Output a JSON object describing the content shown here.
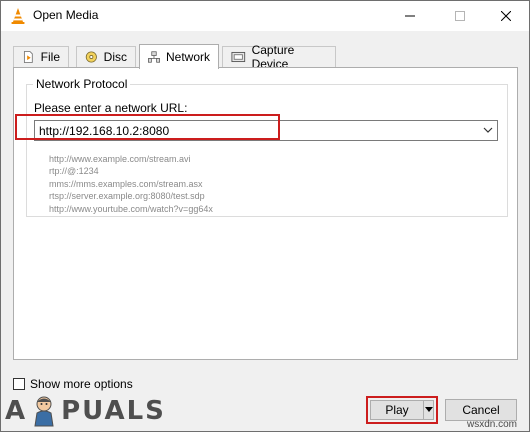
{
  "window": {
    "title": "Open Media"
  },
  "tabs": [
    {
      "label": "File",
      "icon": "file-icon",
      "active": false
    },
    {
      "label": "Disc",
      "icon": "disc-icon",
      "active": false
    },
    {
      "label": "Network",
      "icon": "network-icon",
      "active": true
    },
    {
      "label": "Capture Device",
      "icon": "capture-device-icon",
      "active": false
    }
  ],
  "network": {
    "group_title": "Network Protocol",
    "url_label": "Please enter a network URL:",
    "url_value": "http://192.168.10.2:8080",
    "examples": [
      "http://www.example.com/stream.avi",
      "rtp://@:1234",
      "mms://mms.examples.com/stream.asx",
      "rtsp://server.example.org:8080/test.sdp",
      "http://www.yourtube.com/watch?v=gg64x"
    ]
  },
  "options": {
    "show_more_label": "Show more options",
    "checked": false
  },
  "buttons": {
    "play_label": "Play",
    "cancel_label": "Cancel"
  },
  "watermark": {
    "brand_left": "A",
    "brand_right": "PUALS",
    "site": "wsxdn.com"
  },
  "colors": {
    "highlight": "#cc1d1d",
    "vlc_orange": "#f08a00"
  }
}
